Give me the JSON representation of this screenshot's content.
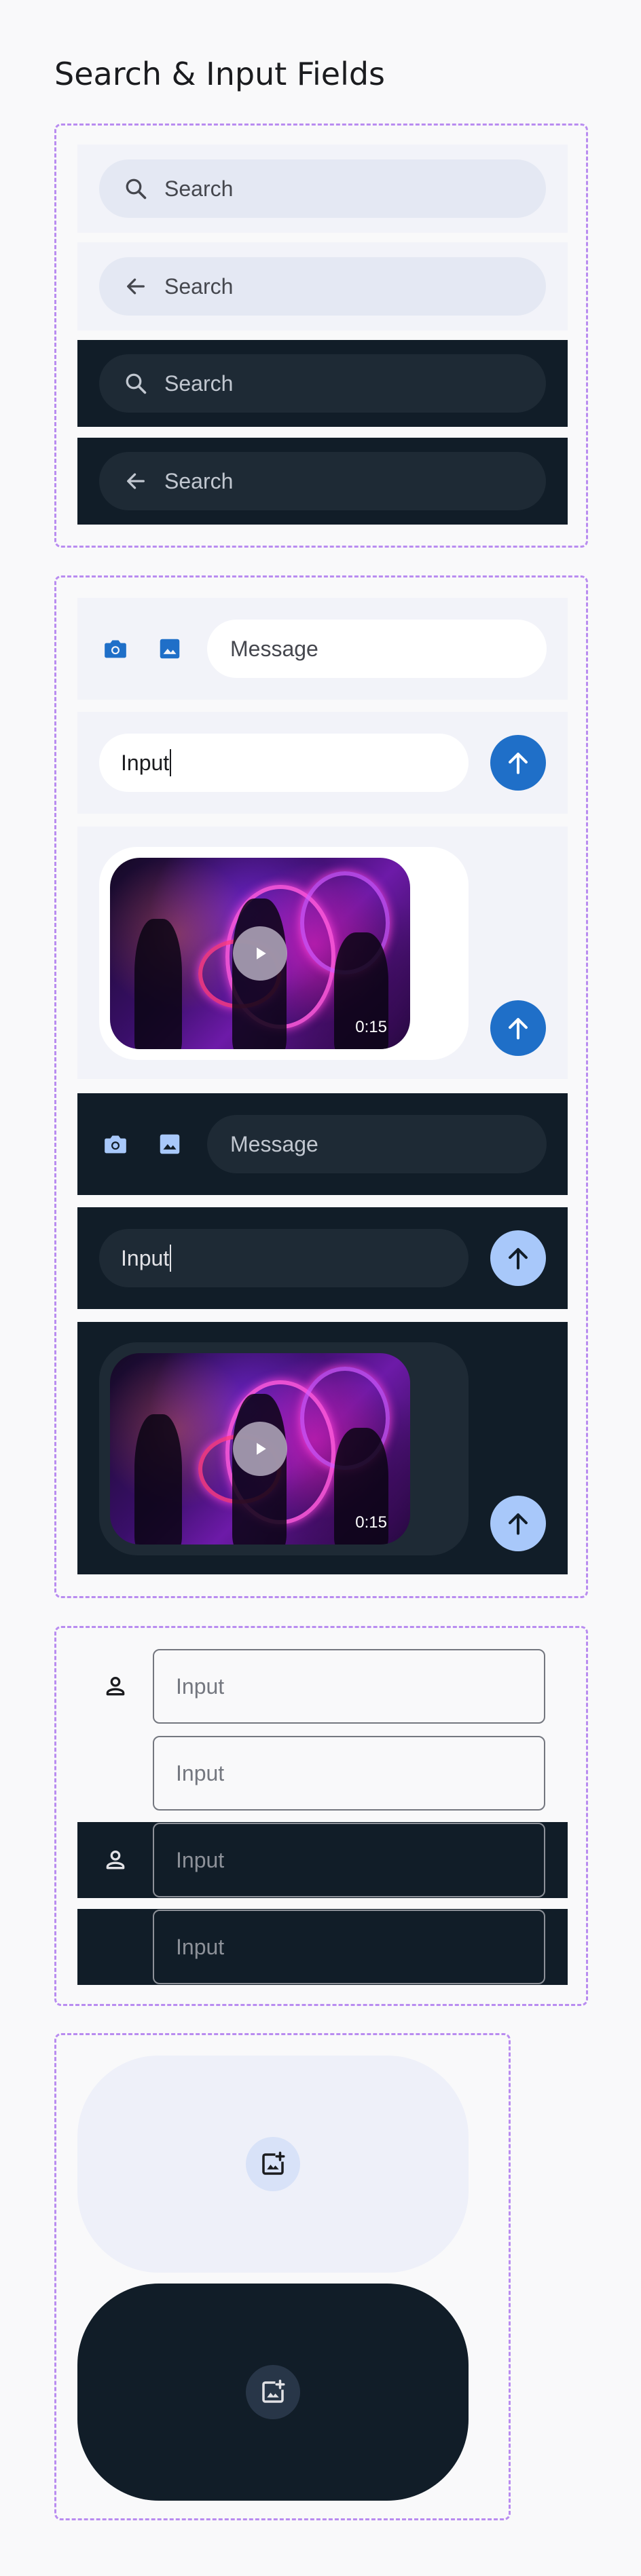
{
  "page": {
    "title": "Search & Input Fields"
  },
  "search": {
    "light_search": {
      "placeholder": "Search",
      "icon": "search-icon"
    },
    "light_back": {
      "placeholder": "Search",
      "icon": "arrow-back-icon"
    },
    "dark_search": {
      "placeholder": "Search",
      "icon": "search-icon"
    },
    "dark_back": {
      "placeholder": "Search",
      "icon": "arrow-back-icon"
    }
  },
  "composer": {
    "message_placeholder": "Message",
    "input_value": "Input",
    "video_duration": "0:15"
  },
  "outlined": {
    "placeholder": "Input"
  },
  "colors": {
    "accent_light": "#1f6fc8",
    "accent_dark": "#a8c8fa",
    "dark_surface": "#111d28",
    "light_surface": "#f2f3f9",
    "outline": "#b98cf0"
  }
}
